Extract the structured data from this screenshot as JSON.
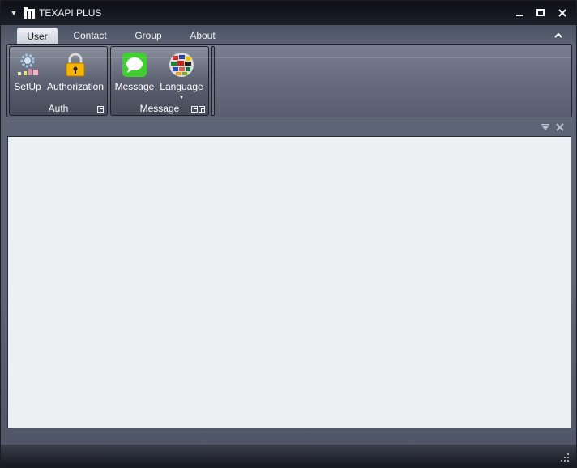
{
  "window": {
    "title": "TEXAPI PLUS",
    "controls": {
      "minimize": "▁",
      "maximize": "□",
      "close": "✕"
    }
  },
  "tabs": [
    {
      "label": "User",
      "active": true
    },
    {
      "label": "Contact",
      "active": false
    },
    {
      "label": "Group",
      "active": false
    },
    {
      "label": "About",
      "active": false
    }
  ],
  "ribbon": {
    "groups": [
      {
        "label": "Auth",
        "buttons": [
          {
            "label": "SetUp",
            "icon": "gear-setup-icon"
          },
          {
            "label": "Authorization",
            "icon": "padlock-icon"
          }
        ]
      },
      {
        "label": "Message",
        "buttons": [
          {
            "label": "Message",
            "icon": "chat-bubble-icon"
          },
          {
            "label": "Language",
            "icon": "flags-globe-icon"
          }
        ]
      }
    ]
  },
  "colors": {
    "titlebar": "#0d0f14",
    "chrome": "#5b6375",
    "document": "#edf0f3",
    "accent_active_tab": "#eef0f4"
  }
}
